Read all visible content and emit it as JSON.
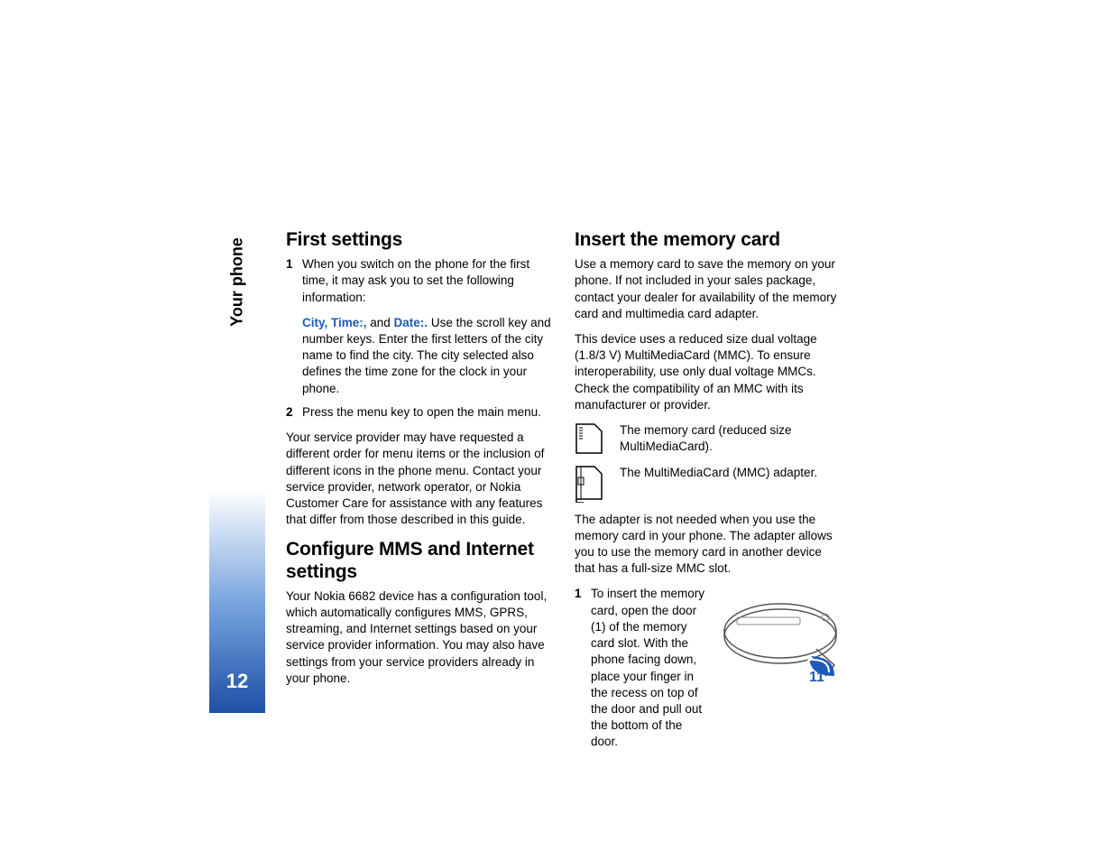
{
  "sidebar": {
    "label": "Your phone",
    "page": "12"
  },
  "col1": {
    "h1": "First settings",
    "step1_num": "1",
    "step1_text": "When you switch on the phone for the first time, it may ask you to set the following information:",
    "kw": "City, Time:, ",
    "kw_and": "and ",
    "kw2": "Date:.",
    "sub_text": " Use the scroll key and number keys. Enter the first letters of the city name to find the city. The city selected also defines the time zone for the clock in your phone.",
    "step2_num": "2",
    "step2_text": "Press the menu key to open the main menu.",
    "p1": "Your service provider may have requested a different order for menu items or the inclusion of different icons in the phone menu. Contact your service provider, network operator, or Nokia Customer Care for assistance with any features that differ from those described in this guide.",
    "h2": "Configure MMS and Internet settings",
    "p2": "Your Nokia 6682 device has a configuration tool, which automatically configures MMS, GPRS, streaming, and Internet settings based on your service provider information. You may also have settings from your service providers already in your phone."
  },
  "col2": {
    "h1": "Insert the memory card",
    "p1": "Use a memory card to save the memory on your phone. If not included in your sales package, contact your dealer for availability of the memory card and multimedia card adapter.",
    "p2": "This device uses a reduced size dual voltage (1.8/3 V) MultiMediaCard (MMC). To ensure interoperability, use only dual voltage MMCs. Check the compatibility of an MMC with its manufacturer or provider.",
    "card_label": "The memory card (reduced size MultiMediaCard).",
    "adapter_label": "The MultiMediaCard (MMC) adapter.",
    "p3": "The adapter is not needed when you use the memory card in your phone. The adapter allows you to use the memory card in another device that has a full-size MMC slot.",
    "step1_num": "1",
    "step1_text": "To insert the memory card, open the door (1) of the memory card slot. With the phone facing down, place your finger in the recess on top of the door and pull out the bottom of the door.",
    "fig_num": "11"
  }
}
